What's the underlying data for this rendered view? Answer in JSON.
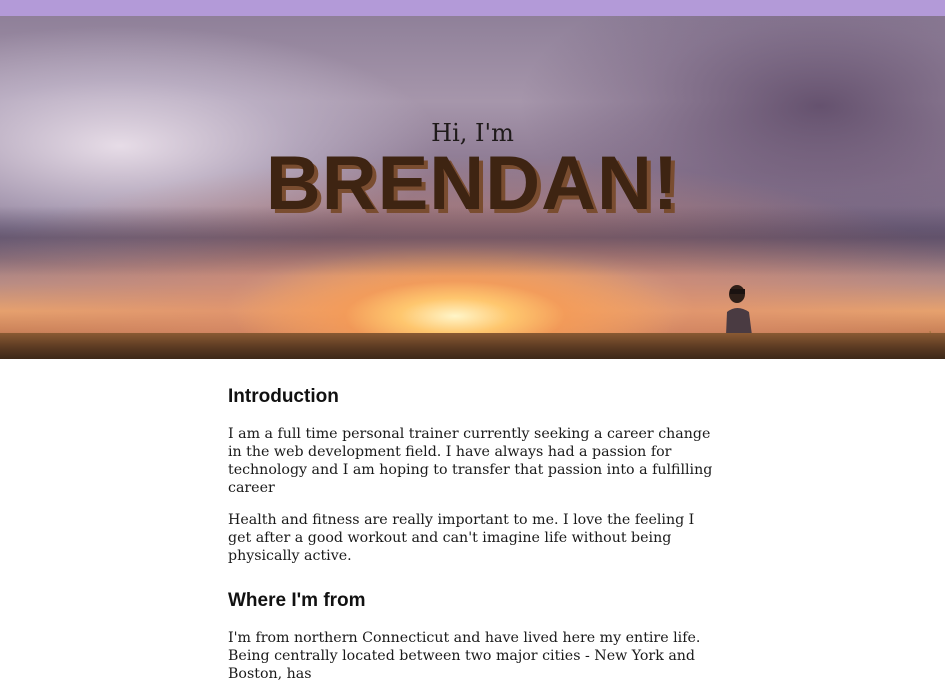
{
  "hero": {
    "greeting": "Hi, I'm",
    "name": "BRENDAN!"
  },
  "sections": [
    {
      "heading": "Introduction",
      "paragraphs": [
        "I am a full time personal trainer currently seeking a career change in the web development field. I have always had a passion for technology and I am hoping to transfer that passion into a fulfilling career",
        "Health and fitness are really important to me. I love the feeling I get after a good workout and can't imagine life without being physically active."
      ]
    },
    {
      "heading": "Where I'm from",
      "paragraphs": [
        "I'm from northern Connecticut and have lived here my entire life. Being centrally located between two major cities - New York and Boston, has"
      ]
    }
  ],
  "colors": {
    "top_bar": "#b39ad8",
    "name_text": "#3e2412"
  }
}
